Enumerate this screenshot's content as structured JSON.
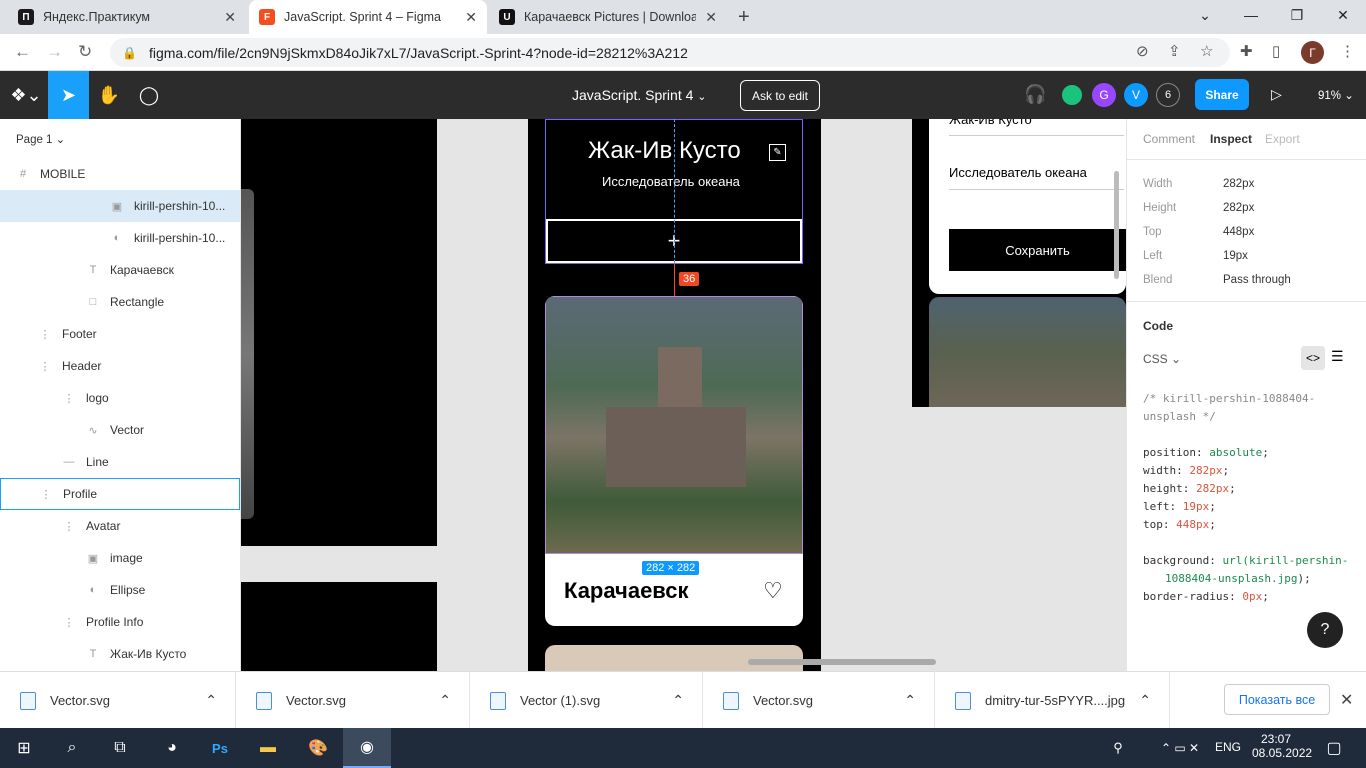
{
  "tabs": [
    {
      "title": "Яндекс.Практикум",
      "icon": "yandex-practicum-icon",
      "fav_color": "#1a1a1a",
      "fav_text": "П"
    },
    {
      "title": "JavaScript. Sprint 4 – Figma",
      "icon": "figma-icon",
      "fav_color": "#f24e1e",
      "fav_text": "F"
    },
    {
      "title": "Карачаевск Pictures | Download",
      "icon": "unsplash-icon",
      "fav_color": "#111",
      "fav_text": "U"
    }
  ],
  "new_tab": "+",
  "url": "figma.com/file/2cn9N9jSkmxD84oJik7xL7/JavaScript.-Sprint-4?node-id=28212%3A212",
  "profile_initial": "Г",
  "figma": {
    "file_name": "JavaScript. Sprint 4",
    "ask_to_edit": "Ask to edit",
    "share": "Share",
    "zoom": "91%",
    "avatars": [
      "G",
      "V"
    ],
    "viewer_count": "6",
    "page": "Page 1"
  },
  "layers": [
    {
      "name": "MOBILE",
      "indent": 16,
      "icon": "#"
    },
    {
      "name": "kirill-pershin-10...",
      "indent": 110,
      "icon": "▣",
      "selected": true
    },
    {
      "name": "kirill-pershin-10...",
      "indent": 110,
      "icon": "◐"
    },
    {
      "name": "Карачаевск",
      "indent": 86,
      "icon": "T"
    },
    {
      "name": "Rectangle",
      "indent": 86,
      "icon": "□"
    },
    {
      "name": "Footer",
      "indent": 38,
      "icon": "⋮"
    },
    {
      "name": "Header",
      "indent": 38,
      "icon": "⋮"
    },
    {
      "name": "logo",
      "indent": 62,
      "icon": "⋮"
    },
    {
      "name": "Vector",
      "indent": 86,
      "icon": "∿"
    },
    {
      "name": "Line",
      "indent": 62,
      "icon": "—"
    },
    {
      "name": "Profile",
      "indent": 38,
      "icon": "⋮",
      "outlined": true
    },
    {
      "name": "Avatar",
      "indent": 62,
      "icon": "⋮"
    },
    {
      "name": "image",
      "indent": 86,
      "icon": "▣"
    },
    {
      "name": "Ellipse",
      "indent": 86,
      "icon": "◐"
    },
    {
      "name": "Profile Info",
      "indent": 62,
      "icon": "⋮"
    },
    {
      "name": "Жак-Ив Кусто",
      "indent": 86,
      "icon": "T"
    }
  ],
  "canvas": {
    "profile_name": "Жак-Ив Кусто",
    "profile_desc": "Исследователь океана",
    "add_glyph": "+",
    "spacing": "36",
    "size_badge": "282 × 282",
    "card_title": "Карачаевск",
    "popup_field1": "Жак-Ив Кусто",
    "popup_field2": "Исследователь океана",
    "popup_save": "Сохранить"
  },
  "inspect": {
    "tabs": [
      "Comment",
      "Inspect",
      "Export"
    ],
    "props": [
      {
        "label": "Width",
        "value": "282px"
      },
      {
        "label": "Height",
        "value": "282px"
      },
      {
        "label": "Top",
        "value": "448px"
      },
      {
        "label": "Left",
        "value": "19px"
      },
      {
        "label": "Blend",
        "value": "Pass through"
      }
    ],
    "code_title": "Code",
    "code_lang": "CSS",
    "comment1": "/* kirill-pershin-1088404-",
    "comment2": "unsplash */",
    "css": [
      {
        "prop": "position:",
        "val": "absolute",
        "kind": "kw"
      },
      {
        "prop": "width:",
        "val": "282px",
        "kind": "num"
      },
      {
        "prop": "height:",
        "val": "282px",
        "kind": "num"
      },
      {
        "prop": "left:",
        "val": "19px",
        "kind": "num"
      },
      {
        "prop": "top:",
        "val": "448px",
        "kind": "num"
      }
    ],
    "bg_prop": "background:",
    "bg_url1": "url(",
    "bg_url_name1": "kirill-pershin-",
    "bg_url_name2": "1088404-unsplash.jpg",
    "bg_end": ");",
    "br_prop": "border-radius:",
    "br_val": "0px",
    "help": "?"
  },
  "downloads": [
    "Vector.svg",
    "Vector.svg",
    "Vector (1).svg",
    "Vector.svg",
    "dmitry-tur-5sPYYR....jpg"
  ],
  "show_all": "Показать все",
  "taskbar": {
    "lang": "ENG",
    "time": "23:07",
    "date": "08.05.2022"
  }
}
